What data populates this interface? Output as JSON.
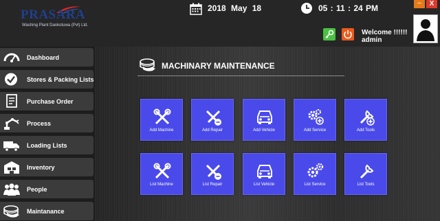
{
  "header": {
    "logo_title": "PRASARA",
    "logo_subtitle": "Washing Plant Dankotuwa (Pvt) Ltd.",
    "date": "2018  May  18",
    "time": "05 : 11 : 24 PM",
    "welcome_line1": "Welcome !!!!!!",
    "welcome_line2": "admin",
    "minimize_label": "–",
    "close_label": "X"
  },
  "sidebar": {
    "items": [
      {
        "label": "Dashboard",
        "icon": "speedometer-icon"
      },
      {
        "label": "Stores & Packing Lists",
        "icon": "checkmark-icon"
      },
      {
        "label": "Purchase Order",
        "icon": "document-list-icon"
      },
      {
        "label": "Process",
        "icon": "robot-arm-icon"
      },
      {
        "label": "Loading Lists",
        "icon": "truck-icon"
      },
      {
        "label": "Inventory",
        "icon": "warehouse-icon"
      },
      {
        "label": "People",
        "icon": "people-icon"
      },
      {
        "label": "Maintanance",
        "icon": "cash-stack-icon"
      }
    ]
  },
  "main": {
    "title": "MACHINARY MAINTENANCE",
    "tiles_row1": [
      {
        "label": "Add Machine",
        "icon": "tools-icon"
      },
      {
        "label": "Add Repair",
        "icon": "repair-icon"
      },
      {
        "label": "Add Vehicle",
        "icon": "vehicle-icon"
      },
      {
        "label": "Add Service",
        "icon": "gears-add-icon"
      },
      {
        "label": "Add Tools",
        "icon": "wrench-add-icon"
      }
    ],
    "tiles_row2": [
      {
        "label": "List Machine",
        "icon": "tools-icon"
      },
      {
        "label": "List Repair",
        "icon": "repair-icon"
      },
      {
        "label": "List Vehicle",
        "icon": "vehicle-icon"
      },
      {
        "label": "List Service",
        "icon": "gears-icon"
      },
      {
        "label": "List Tools",
        "icon": "wrench-icon"
      }
    ]
  },
  "colors": {
    "tile": "#4a4aea",
    "header": "#262626",
    "logo": "#1f3f8f",
    "key_button": "#4cc043",
    "power_button": "#ea5a1c"
  }
}
